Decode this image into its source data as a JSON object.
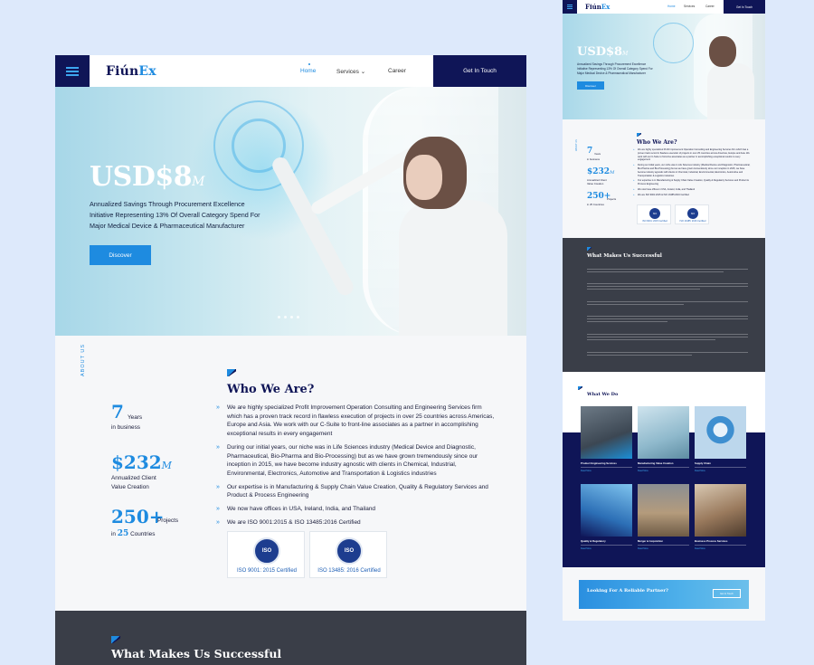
{
  "brand": {
    "name_prefix": "Fiún",
    "name_suffix": "Ex"
  },
  "colors": {
    "accent": "#1e8be0",
    "navy": "#0f1557",
    "dark": "#3a3e48",
    "bg": "#dde9fb"
  },
  "icons": {
    "menu": "hamburger-icon",
    "bullet": "chevron-right-icon",
    "dropdown": "chevron-down-icon"
  },
  "nav": {
    "home": "Home",
    "services": "Services",
    "career": "Career",
    "cta": "Get In Touch"
  },
  "hero": {
    "amount": "USD$8",
    "amount_suffix": "M",
    "desc_line1": "Annualized Savings Through Procurement Excellence",
    "desc_line2": "Initiative Representing 13% Of Overall Category Spend For",
    "desc_line3": "Major Medical Device & Pharmaceutical Manufacturer",
    "button": "Discover"
  },
  "about": {
    "vertical_label": "ABOUT US",
    "title": "Who We Are?",
    "stats": [
      {
        "value": "7",
        "unit": "Years",
        "label": "in business"
      },
      {
        "value": "$232",
        "unit": "M",
        "label_line1": "Annualized Client",
        "label_line2": "Value Creation"
      },
      {
        "value": "250+",
        "unit": "Projects",
        "label_prefix": "in",
        "label_num": "25",
        "label_suffix": "Countries"
      }
    ],
    "bullets": [
      "We are highly specialized Profit Improvement Operation Consulting and Engineering Services firm which has a proven track record in flawless execution of projects in over 25 countries across Americas, Europe and Asia. We work with our C-Suite to front-line associates as a partner in accomplishing exceptional results in every engagement",
      "During our initial years, our niche was in Life Sciences industry (Medical Device and Diagnostic, Pharmaceutical, Bio-Pharma and Bio-Processing) but as we have grown tremendously since our inception in 2015, we have become industry agnostic with clients in Chemical, Industrial, Environmental, Electronics, Automotive and Transportation & Logistics industries",
      "Our expertise is in Manufacturing & Supply Chain Value Creation, Quality & Regulatory Services and Product & Process Engineering",
      "We now have offices in USA, Ireland, India, and Thailand",
      "We are ISO 9001:2015 & ISO 13485:2016 Certified"
    ],
    "certs": [
      {
        "seal": "ISO",
        "label": "ISO 9001: 2015 Certified"
      },
      {
        "seal": "ISO",
        "label": "ISO 13485: 2016 Certified"
      }
    ]
  },
  "success": {
    "title": "What Makes Us Successful"
  },
  "what_we_do": {
    "title": "What We Do",
    "cards": [
      {
        "name": "Product Engineering Services",
        "read_more": "Read More"
      },
      {
        "name": "Manufacturing Value Creation",
        "read_more": "Read More"
      },
      {
        "name": "Supply Chain",
        "read_more": "Read More"
      },
      {
        "name": "Quality & Regulatory",
        "read_more": "Read More"
      },
      {
        "name": "Merger & Acquisition",
        "read_more": "Read More"
      },
      {
        "name": "Business Process Services",
        "read_more": "Read More"
      }
    ]
  },
  "partner": {
    "title": "Looking For A Reliable Partner?",
    "button": "Get In Touch"
  }
}
